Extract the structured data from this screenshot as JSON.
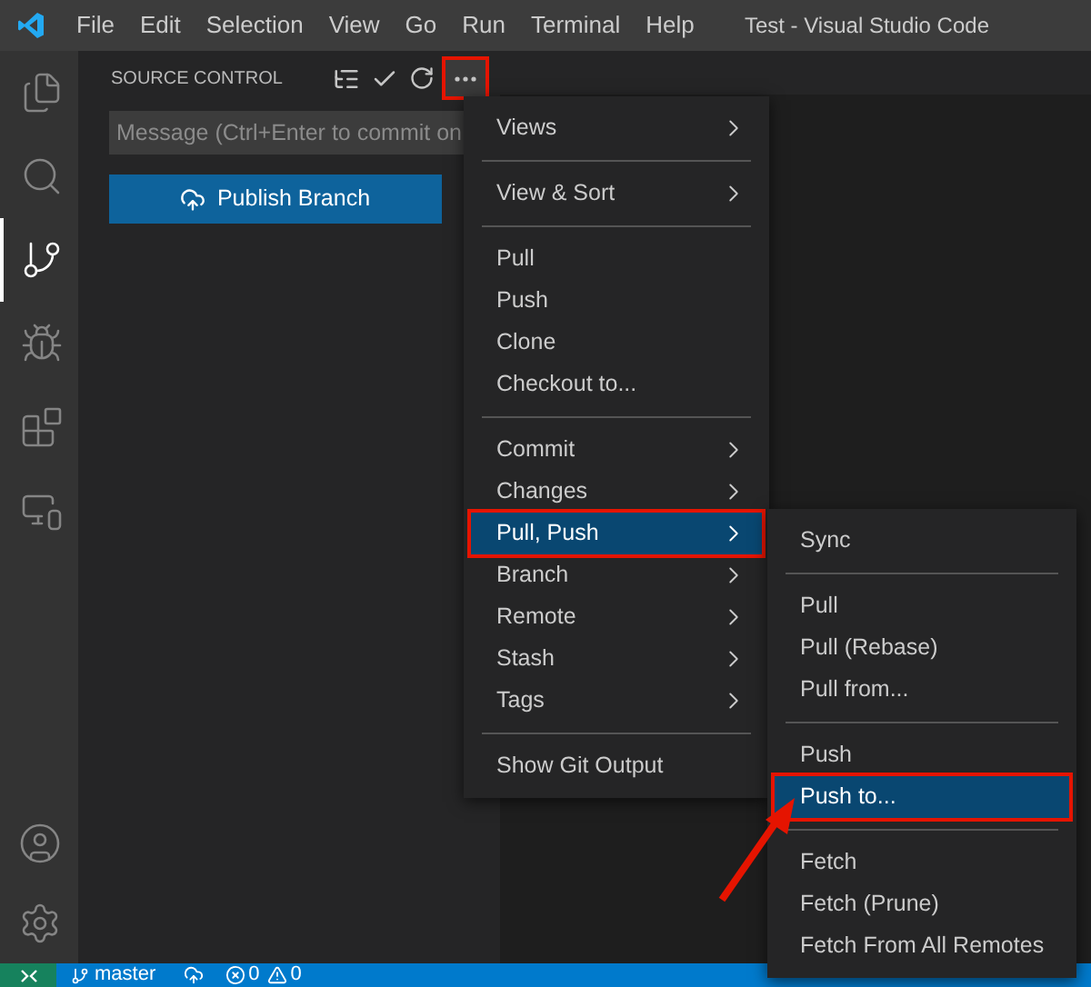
{
  "title_bar": {
    "menus": [
      "File",
      "Edit",
      "Selection",
      "View",
      "Go",
      "Run",
      "Terminal",
      "Help"
    ],
    "title": "Test - Visual Studio Code"
  },
  "activity_bar": [
    {
      "kind": "files",
      "selected": false
    },
    {
      "kind": "search",
      "selected": false
    },
    {
      "kind": "scm",
      "selected": true
    },
    {
      "kind": "debug",
      "selected": false
    },
    {
      "kind": "extensions",
      "selected": false
    },
    {
      "kind": "remote",
      "selected": false
    }
  ],
  "activity_bar_bottom": [
    {
      "kind": "account"
    },
    {
      "kind": "settings"
    }
  ],
  "sidebar": {
    "title": "SOURCE CONTROL",
    "more_marked": true,
    "message": {
      "placeholder": "Message (Ctrl+Enter to commit on"
    },
    "publish_button": "Publish Branch"
  },
  "menu": {
    "groups": [
      [
        {
          "label": "Views",
          "submenu": true,
          "selected": false,
          "marked": false
        }
      ],
      [
        {
          "label": "View & Sort",
          "submenu": true,
          "selected": false,
          "marked": false
        }
      ],
      [
        {
          "label": "Pull",
          "submenu": false,
          "selected": false,
          "marked": false
        },
        {
          "label": "Push",
          "submenu": false,
          "selected": false,
          "marked": false
        },
        {
          "label": "Clone",
          "submenu": false,
          "selected": false,
          "marked": false
        },
        {
          "label": "Checkout to...",
          "submenu": false,
          "selected": false,
          "marked": false
        }
      ],
      [
        {
          "label": "Commit",
          "submenu": true,
          "selected": false,
          "marked": false
        },
        {
          "label": "Changes",
          "submenu": true,
          "selected": false,
          "marked": false
        },
        {
          "label": "Pull, Push",
          "submenu": true,
          "selected": true,
          "marked": true
        },
        {
          "label": "Branch",
          "submenu": true,
          "selected": false,
          "marked": false
        },
        {
          "label": "Remote",
          "submenu": true,
          "selected": false,
          "marked": false
        },
        {
          "label": "Stash",
          "submenu": true,
          "selected": false,
          "marked": false
        },
        {
          "label": "Tags",
          "submenu": true,
          "selected": false,
          "marked": false
        }
      ],
      [
        {
          "label": "Show Git Output",
          "submenu": false,
          "selected": false,
          "marked": false
        }
      ]
    ]
  },
  "submenu": {
    "groups": [
      [
        {
          "label": "Sync",
          "selected": false,
          "marked": false
        }
      ],
      [
        {
          "label": "Pull",
          "selected": false,
          "marked": false
        },
        {
          "label": "Pull (Rebase)",
          "selected": false,
          "marked": false
        },
        {
          "label": "Pull from...",
          "selected": false,
          "marked": false
        }
      ],
      [
        {
          "label": "Push",
          "selected": false,
          "marked": false
        },
        {
          "label": "Push to...",
          "selected": true,
          "marked": true
        }
      ],
      [
        {
          "label": "Fetch",
          "selected": false,
          "marked": false
        },
        {
          "label": "Fetch (Prune)",
          "selected": false,
          "marked": false
        },
        {
          "label": "Fetch From All Remotes",
          "selected": false,
          "marked": false
        }
      ]
    ]
  },
  "status_bar": {
    "branch": "master",
    "errors": "0",
    "warnings": "0"
  }
}
